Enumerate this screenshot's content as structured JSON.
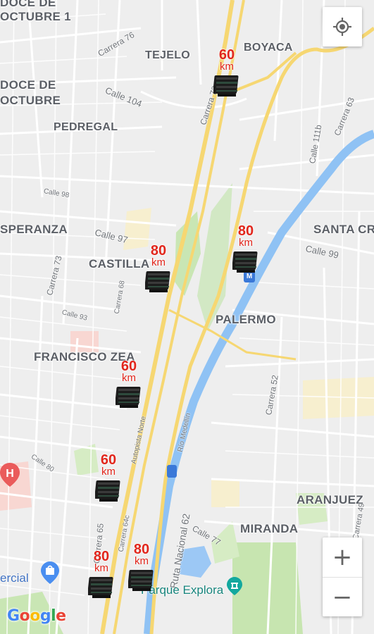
{
  "neighborhoods": [
    {
      "id": "doce-octubre-1",
      "text": "DOCE DE\nOCTUBRE 1"
    },
    {
      "id": "tejelo",
      "text": "TEJELO"
    },
    {
      "id": "boyaca",
      "text": "BOYACA"
    },
    {
      "id": "doce-octubre",
      "text": "DOCE DE\nOCTUBRE"
    },
    {
      "id": "pedregal",
      "text": "PEDREGAL"
    },
    {
      "id": "esperanza",
      "text": "SPERANZA"
    },
    {
      "id": "santa-cruz",
      "text": "SANTA CR"
    },
    {
      "id": "castilla",
      "text": "CASTILLA"
    },
    {
      "id": "palermo",
      "text": "PALERMO"
    },
    {
      "id": "francisco-zea",
      "text": "FRANCISCO ZEA"
    },
    {
      "id": "aranjuez",
      "text": "ARANJUEZ"
    },
    {
      "id": "miranda",
      "text": "MIRANDA"
    }
  ],
  "streets": [
    {
      "id": "carrera-76",
      "text": "Carrera 76"
    },
    {
      "id": "calle-104",
      "text": "Calle 104"
    },
    {
      "id": "carrera-72",
      "text": "Carrera 72"
    },
    {
      "id": "calle-111b",
      "text": "Calle 111b"
    },
    {
      "id": "carrera-63",
      "text": "Carrera 63"
    },
    {
      "id": "calle-98",
      "text": "Calle 98"
    },
    {
      "id": "calle-97",
      "text": "Calle 97"
    },
    {
      "id": "calle-99",
      "text": "Calle 99"
    },
    {
      "id": "carrera-73",
      "text": "Carrera 73"
    },
    {
      "id": "carrera-68",
      "text": "Carrera 68"
    },
    {
      "id": "calle-93",
      "text": "Calle 93"
    },
    {
      "id": "carrera-52",
      "text": "Carrera 52"
    },
    {
      "id": "autopista-norte",
      "text": "Autopista Norte"
    },
    {
      "id": "rio-medellin",
      "text": "Río Medellín"
    },
    {
      "id": "calle-80",
      "text": "Calle 80"
    },
    {
      "id": "carrera-65",
      "text": "Carrera 65"
    },
    {
      "id": "carrera-64c",
      "text": "Carrera 64c"
    },
    {
      "id": "ruta-nacional-62",
      "text": "Ruta Nacional 62"
    },
    {
      "id": "calle-77",
      "text": "Calle 77"
    },
    {
      "id": "carrera-49",
      "text": "Carrera 49"
    }
  ],
  "cameras": [
    {
      "id": "cam-1",
      "speed": "60",
      "unit": "km"
    },
    {
      "id": "cam-2",
      "speed": "80",
      "unit": "km"
    },
    {
      "id": "cam-3",
      "speed": "80",
      "unit": "km"
    },
    {
      "id": "cam-4",
      "speed": "60",
      "unit": "km"
    },
    {
      "id": "cam-5",
      "speed": "60",
      "unit": "km"
    },
    {
      "id": "cam-6",
      "speed": "80",
      "unit": "km"
    },
    {
      "id": "cam-7",
      "speed": "80",
      "unit": "km"
    }
  ],
  "pois": {
    "comercial": "ercial",
    "parque_explora": "Parque Explora"
  },
  "controls": {
    "zoom_in": "+",
    "zoom_out": "−",
    "locate_icon": "crosshair-icon"
  },
  "google_logo": {
    "letters": [
      "G",
      "o",
      "o",
      "g",
      "l",
      "e"
    ],
    "colors": [
      "#4285F4",
      "#EA4335",
      "#FBBC05",
      "#4285F4",
      "#34A853",
      "#EA4335"
    ]
  },
  "colors": {
    "map_bg": "#eeeeee",
    "road": "#ffffff",
    "highway": "#f6d772",
    "river": "#8fc2f4",
    "park": "#c9e6b4",
    "speed_text": "#e1261c",
    "label": "#5b5f66"
  }
}
